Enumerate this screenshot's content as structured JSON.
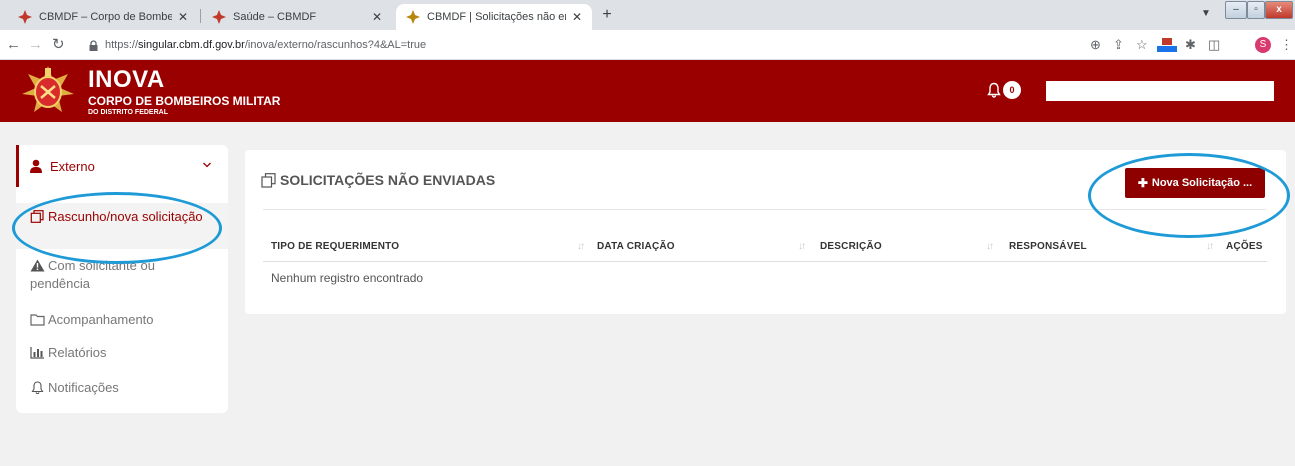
{
  "browser": {
    "tabs": [
      {
        "title": "CBMDF – Corpo de Bombeiros M",
        "active": false
      },
      {
        "title": "Saúde – CBMDF",
        "active": false
      },
      {
        "title": "CBMDF | Solicitações não enviad",
        "active": true
      }
    ],
    "new_tab_symbol": "+",
    "url_scheme": "https://",
    "url_host": "singular.cbm.df.gov.br",
    "url_path": "/inova/externo/rascunhos?4&AL=true",
    "profile_initial": "S"
  },
  "header": {
    "brand_title": "INOVA",
    "brand_subtitle": "CORPO DE BOMBEIROS MILITAR",
    "brand_subtitle2": "DO DISTRITO FEDERAL",
    "notification_count": "0",
    "search_value": ""
  },
  "sidebar": {
    "group_label": "Externo",
    "items": [
      {
        "label": "Rascunho/nova solicitação",
        "icon": "draft-copy-icon",
        "active": true
      },
      {
        "label": "Com solicitante ou pendência",
        "icon": "warning-icon",
        "active": false
      },
      {
        "label": "Acompanhamento",
        "icon": "folder-icon",
        "active": false
      },
      {
        "label": "Relatórios",
        "icon": "bar-chart-icon",
        "active": false
      },
      {
        "label": "Notificações",
        "icon": "bell-icon",
        "active": false
      }
    ]
  },
  "main": {
    "title": "SOLICITAÇÕES NÃO ENVIADAS",
    "new_button_label": "Nova Solicitação ...",
    "columns": [
      "TIPO DE REQUERIMENTO",
      "DATA CRIAÇÃO",
      "DESCRIÇÃO",
      "RESPONSÁVEL",
      "AÇÕES"
    ],
    "empty_message": "Nenhum registro encontrado"
  },
  "colors": {
    "brand_red": "#9b0000",
    "button_red": "#8e0000",
    "annotation_blue": "#1e9ad6"
  }
}
